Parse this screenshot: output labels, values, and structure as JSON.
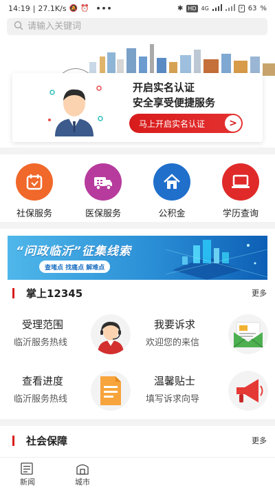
{
  "status_bar": {
    "time": "14:19",
    "speed": "27.1K/s",
    "network": "4G",
    "hd": "HD",
    "battery_percent": "63",
    "battery_level": 0.63
  },
  "search": {
    "placeholder": "请输入关键词"
  },
  "banner": {
    "line1": "开启实名认证",
    "line2": "安全享受便捷服务",
    "button_label": "马上开启实名认证",
    "button_arrow": ">"
  },
  "services": [
    {
      "label": "社保服务",
      "icon": "calendar-icon",
      "color": "#f0682a"
    },
    {
      "label": "医保服务",
      "icon": "ambulance-icon",
      "color": "#b63b9d"
    },
    {
      "label": "公积金",
      "icon": "house-icon",
      "color": "#1f6fcb"
    },
    {
      "label": "学历查询",
      "icon": "laptop-icon",
      "color": "#e02a2a"
    }
  ],
  "ad": {
    "title": "“问政临沂”征集线索",
    "subtitle": "查堵点 找痛点 解难点"
  },
  "section_12345": {
    "title": "掌上12345",
    "more": "更多",
    "items": [
      {
        "title": "受理范围",
        "sub": "临沂服务热线",
        "icon": "operator-icon"
      },
      {
        "title": "我要诉求",
        "sub": "欢迎您的来信",
        "icon": "envelope-icon"
      },
      {
        "title": "查看进度",
        "sub": "临沂服务热线",
        "icon": "document-icon"
      },
      {
        "title": "温馨贴士",
        "sub": "填写诉求向导",
        "icon": "megaphone-icon"
      }
    ]
  },
  "section_social": {
    "title": "社会保障",
    "more": "更多"
  },
  "bottom_nav": [
    {
      "label": "新闻",
      "icon": "news-icon"
    },
    {
      "label": "城市",
      "icon": "city-icon"
    }
  ],
  "colors": {
    "accent_red": "#d81b1b",
    "ad_blue": "#2b8fd6"
  }
}
